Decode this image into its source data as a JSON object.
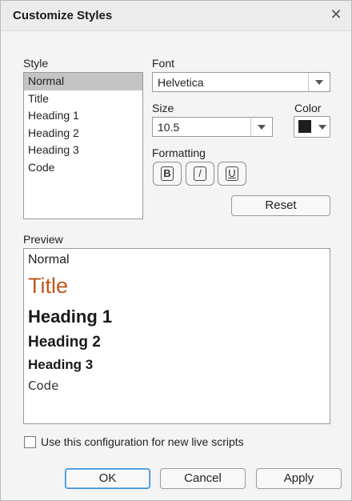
{
  "window": {
    "title": "Customize Styles",
    "close_glyph": "✕"
  },
  "style_label": "Style",
  "style_list": [
    "Normal",
    "Title",
    "Heading 1",
    "Heading 2",
    "Heading 3",
    "Code"
  ],
  "selected_style": "Normal",
  "font": {
    "label": "Font",
    "value": "Helvetica"
  },
  "size": {
    "label": "Size",
    "value": "10.5"
  },
  "color": {
    "label": "Color",
    "value": "#1e1e1e"
  },
  "formatting": {
    "label": "Formatting",
    "bold": "B",
    "italic": "/",
    "underline": "U"
  },
  "reset_label": "Reset",
  "preview": {
    "label": "Preview",
    "normal": "Normal",
    "title": "Title",
    "title_color": "#c0571e",
    "h1": "Heading 1",
    "h2": "Heading 2",
    "h3": "Heading 3",
    "code": "Code"
  },
  "checkbox_label": "Use this configuration for new live scripts",
  "checkbox_checked": false,
  "buttons": {
    "ok": "OK",
    "cancel": "Cancel",
    "apply": "Apply"
  }
}
